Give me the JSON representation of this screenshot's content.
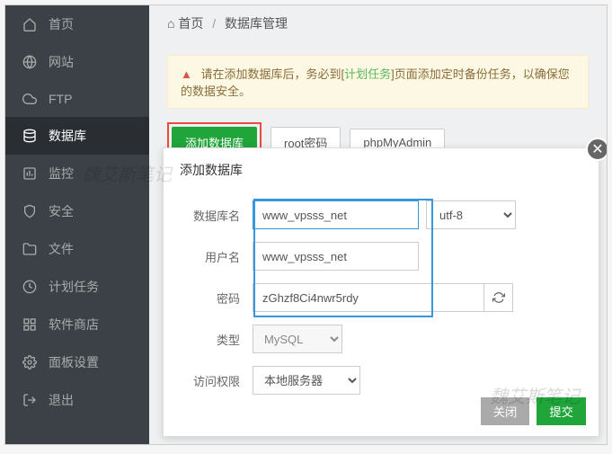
{
  "breadcrumb": {
    "home": "首页",
    "current": "数据库管理"
  },
  "sidebar": {
    "items": [
      {
        "label": "首页"
      },
      {
        "label": "网站"
      },
      {
        "label": "FTP"
      },
      {
        "label": "数据库"
      },
      {
        "label": "监控"
      },
      {
        "label": "安全"
      },
      {
        "label": "文件"
      },
      {
        "label": "计划任务"
      },
      {
        "label": "软件商店"
      },
      {
        "label": "面板设置"
      },
      {
        "label": "退出"
      }
    ]
  },
  "alert": {
    "prefix": "请在添加数据库后，务必到[",
    "link": "计划任务",
    "suffix": "]页面添加定时备份任务，以确保您的数据安全。"
  },
  "toolbar": {
    "add": "添加数据库",
    "rootpwd": "root密码",
    "phpmyadmin": "phpMyAdmin"
  },
  "modal": {
    "title": "添加数据库",
    "labels": {
      "dbname": "数据库名",
      "user": "用户名",
      "pwd": "密码",
      "type": "类型",
      "access": "访问权限"
    },
    "values": {
      "dbname": "www_vpsss_net",
      "user": "www_vpsss_net",
      "pwd": "zGhzf8Ci4nwr5rdy",
      "charset": "utf-8",
      "type": "MySQL",
      "access": "本地服务器"
    },
    "buttons": {
      "cancel": "关闭",
      "submit": "提交"
    }
  },
  "watermarks": {
    "w1": "魏艾斯笔记",
    "w2": "魏艾斯笔记"
  }
}
